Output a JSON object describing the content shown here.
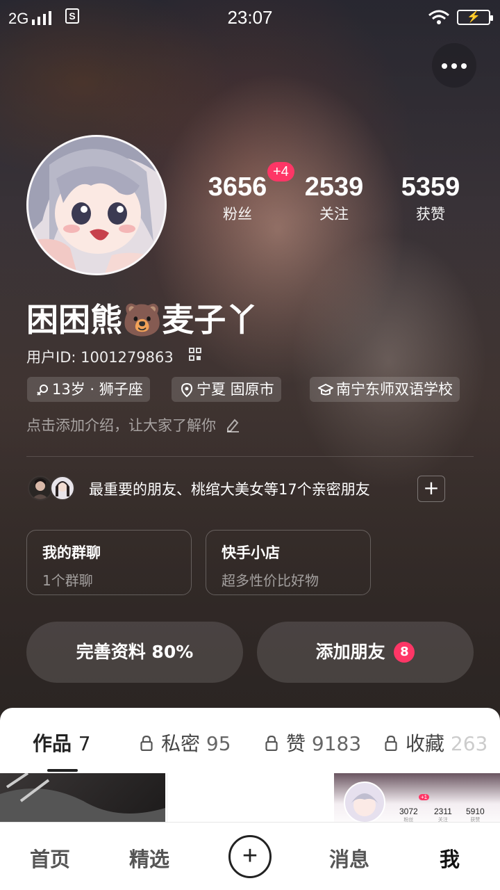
{
  "status_bar": {
    "network": "2G",
    "time": "23:07",
    "battery_icon": "battery-charging-icon"
  },
  "profile": {
    "nickname": "困困熊🐻麦子丫",
    "user_id": "用户ID: 1001279863",
    "stats": [
      {
        "num": "3656",
        "label": "粉丝"
      },
      {
        "num": "2539",
        "label": "关注"
      },
      {
        "num": "5359",
        "label": "获赞"
      }
    ],
    "fans_badge": "+4",
    "tags": [
      {
        "icon": "gender-female-icon",
        "label": "13岁 · 狮子座"
      },
      {
        "icon": "location-pin-icon",
        "label": "宁夏 固原市"
      },
      {
        "icon": "graduation-cap-icon",
        "label": "南宁东师双语学校"
      }
    ],
    "intro_placeholder": "点击添加介绍，让大家了解你"
  },
  "friends": {
    "text": "最重要的朋友、桃绾大美女等17个亲密朋友",
    "add": "+"
  },
  "cards": [
    {
      "title": "我的群聊",
      "sub": "1个群聊"
    },
    {
      "title": "快手小店",
      "sub": "超多性价比好物"
    }
  ],
  "buttons": {
    "complete_profile": "完善资料 80%",
    "add_friend": "添加朋友",
    "add_friend_badge": "8"
  },
  "tabs": [
    {
      "label": "作品",
      "count": "7",
      "locked": false
    },
    {
      "label": "私密",
      "count": "95",
      "locked": true
    },
    {
      "label": "赞",
      "count": "9183",
      "locked": true
    },
    {
      "label": "收藏",
      "count": "263",
      "locked": true
    }
  ],
  "thumb_stats": {
    "badge": "+1",
    "items": [
      {
        "num": "3072",
        "label": "粉丝"
      },
      {
        "num": "2311",
        "label": "关注"
      },
      {
        "num": "5910",
        "label": "获赞"
      }
    ]
  },
  "bottom_nav": [
    "首页",
    "精选",
    "+",
    "消息",
    "我"
  ],
  "colors": {
    "accent": "#fe3666",
    "sheet": "#ffffff"
  }
}
